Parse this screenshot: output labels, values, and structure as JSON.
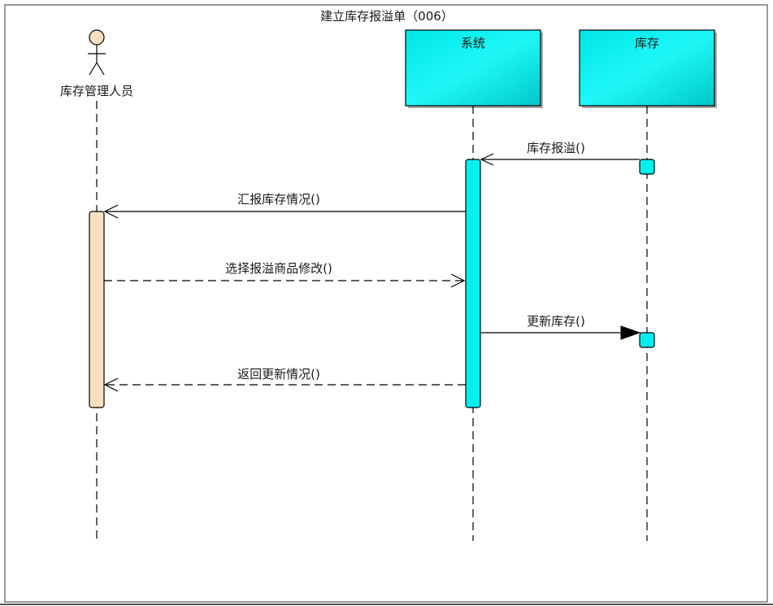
{
  "title": "建立库存报溢单（006）",
  "actor": {
    "name": "库存管理人员",
    "color": "#f7dfbf"
  },
  "participants": [
    {
      "name": "系统"
    },
    {
      "name": "库存"
    }
  ],
  "messages": [
    {
      "label": "库存报溢()",
      "style": "solid",
      "arrow": "open"
    },
    {
      "label": "汇报库存情况()",
      "style": "solid",
      "arrow": "open"
    },
    {
      "label": "选择报溢商品修改()",
      "style": "dashed",
      "arrow": "open"
    },
    {
      "label": "更新库存()",
      "style": "solid",
      "arrow": "filled"
    },
    {
      "label": "返回更新情况()",
      "style": "dashed",
      "arrow": "open"
    }
  ],
  "colors": {
    "participant_fill": "#00f0f0",
    "activation_fill": "#00f0f0",
    "actor_activation_fill": "#f7dfbf",
    "line": "#000000"
  }
}
